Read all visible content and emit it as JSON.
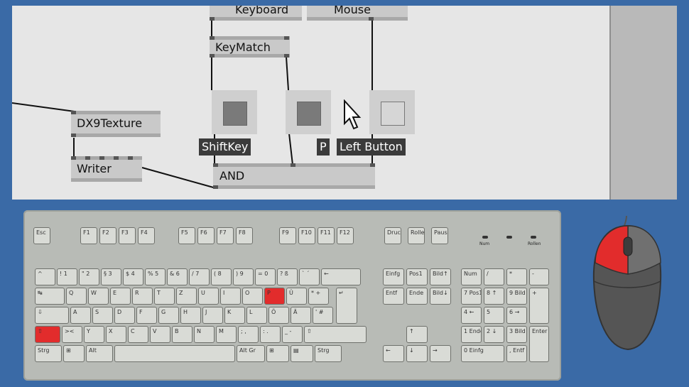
{
  "patch": {
    "nodes": {
      "keyboard": "Keyboard",
      "mouse": "Mouse",
      "keymatch": "KeyMatch",
      "dx9texture": "DX9Texture",
      "writer": "Writer",
      "and": "AND"
    },
    "tags": {
      "shiftkey": "ShiftKey",
      "p": "P",
      "left_button": "Left Button"
    }
  },
  "keyboard": {
    "fn_row": [
      "Esc",
      "F1",
      "F2",
      "F3",
      "F4",
      "F5",
      "F6",
      "F7",
      "F8",
      "F9",
      "F10",
      "F11",
      "F12",
      "Druck",
      "Rollen",
      "Pause"
    ],
    "leds": [
      "Num",
      "",
      "Rollen"
    ],
    "row1": [
      "^",
      "!\n1",
      "\"\n2",
      "§\n3",
      "$\n4",
      "%\n5",
      "&\n6",
      "/\n7",
      "(\n8",
      ")\n9",
      "=\n0",
      "?\nß",
      "`\n´",
      "←"
    ],
    "row2": [
      "↹",
      "Q",
      "W",
      "E",
      "R",
      "T",
      "Z",
      "U",
      "I",
      "O",
      "P",
      "Ü",
      "*\n+"
    ],
    "row3": [
      "⇩",
      "A",
      "S",
      "D",
      "F",
      "G",
      "H",
      "J",
      "K",
      "L",
      "Ö",
      "Ä",
      "'\n#"
    ],
    "row4": [
      "⇧",
      "><",
      "Y",
      "X",
      "C",
      "V",
      "B",
      "N",
      "M",
      ";\n,",
      ":\n.",
      "_\n-",
      "⇧"
    ],
    "row5": [
      "Strg",
      "⊞",
      "Alt",
      "",
      "Alt Gr",
      "⊞",
      "▤",
      "Strg"
    ],
    "nav": [
      "Einfg",
      "Pos1",
      "Bild↑",
      "Entf",
      "Ende",
      "Bild↓"
    ],
    "arrows": [
      "↑",
      "←",
      "↓",
      "→"
    ],
    "numpad": [
      "Num",
      "/",
      "*",
      "-",
      "7\nPos1",
      "8\n↑",
      "9\nBild↑",
      "+",
      "4\n←",
      "5",
      "6\n→",
      "1\nEnde",
      "2\n↓",
      "3\nBild↓",
      "Enter",
      "0\nEinfg",
      ",\nEntf"
    ],
    "highlighted": [
      "P",
      "⇧ (left shift)"
    ],
    "highlight_color": "#e22c2c"
  },
  "mouse": {
    "highlighted": "left-button",
    "highlight_color": "#e22c2c"
  }
}
